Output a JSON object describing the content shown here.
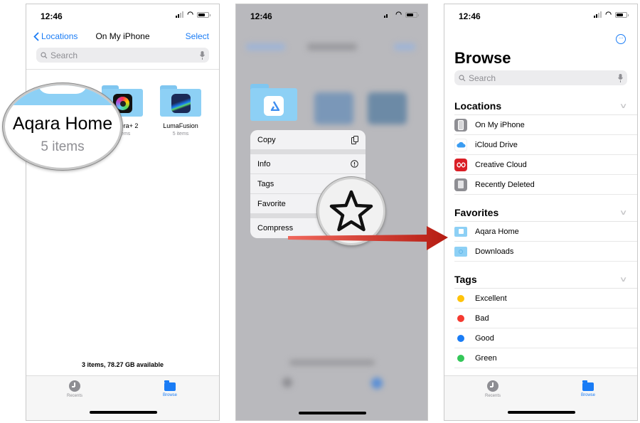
{
  "status_bar": {
    "time": "12:46"
  },
  "panel_files": {
    "nav": {
      "back_label": "Locations",
      "title": "On My iPhone",
      "select_label": "Select"
    },
    "search_placeholder": "Search",
    "folders": [
      {
        "name": "Aqara Home",
        "items": "5 items",
        "icon": "aqara-app-icon",
        "color": "#8dd0f5"
      },
      {
        "name": "Camera+ 2",
        "items": "5 items",
        "icon": "camera-plus-app-icon",
        "color": "#8dd0f5"
      },
      {
        "name": "LumaFusion",
        "items": "5 items",
        "icon": "lumafusion-app-icon",
        "color": "#8dd0f5"
      }
    ],
    "magnifier": {
      "title": "Aqara Home",
      "subtitle": "5 items"
    },
    "footer": "3 items, 78.27 GB available",
    "tabs": [
      {
        "label": "Recents",
        "icon": "clock-icon",
        "active": false
      },
      {
        "label": "Browse",
        "icon": "folder-icon",
        "active": true
      }
    ]
  },
  "panel_context_menu": {
    "items": [
      {
        "label": "Copy",
        "icon": "copy-icon"
      },
      {
        "label": "Info",
        "icon": "info-icon"
      },
      {
        "label": "Tags",
        "icon": ""
      },
      {
        "label": "Favorite",
        "icon": "star-icon"
      },
      {
        "label": "Compress",
        "icon": ""
      }
    ]
  },
  "panel_browse": {
    "title": "Browse",
    "search_placeholder": "Search",
    "sections": [
      {
        "title": "Locations",
        "items": [
          {
            "label": "On My iPhone",
            "icon": "iphone-icon"
          },
          {
            "label": "iCloud Drive",
            "icon": "icloud-icon"
          },
          {
            "label": "Creative Cloud",
            "icon": "creative-cloud-icon"
          },
          {
            "label": "Recently Deleted",
            "icon": "trash-icon"
          }
        ]
      },
      {
        "title": "Favorites",
        "items": [
          {
            "label": "Aqara Home",
            "icon": "folder-icon"
          },
          {
            "label": "Downloads",
            "icon": "downloads-folder-icon"
          }
        ]
      },
      {
        "title": "Tags",
        "items": [
          {
            "label": "Excellent",
            "color": "#ffc30a"
          },
          {
            "label": "Bad",
            "color": "#f53a30"
          },
          {
            "label": "Good",
            "color": "#1a7cf5"
          },
          {
            "label": "Green",
            "color": "#34c759"
          }
        ]
      }
    ],
    "tabs": [
      {
        "label": "Recents",
        "icon": "clock-icon",
        "active": false
      },
      {
        "label": "Browse",
        "icon": "folder-icon",
        "active": true
      }
    ]
  },
  "colors": {
    "accent": "#1a7cf5",
    "arrow": "#c8261c"
  }
}
